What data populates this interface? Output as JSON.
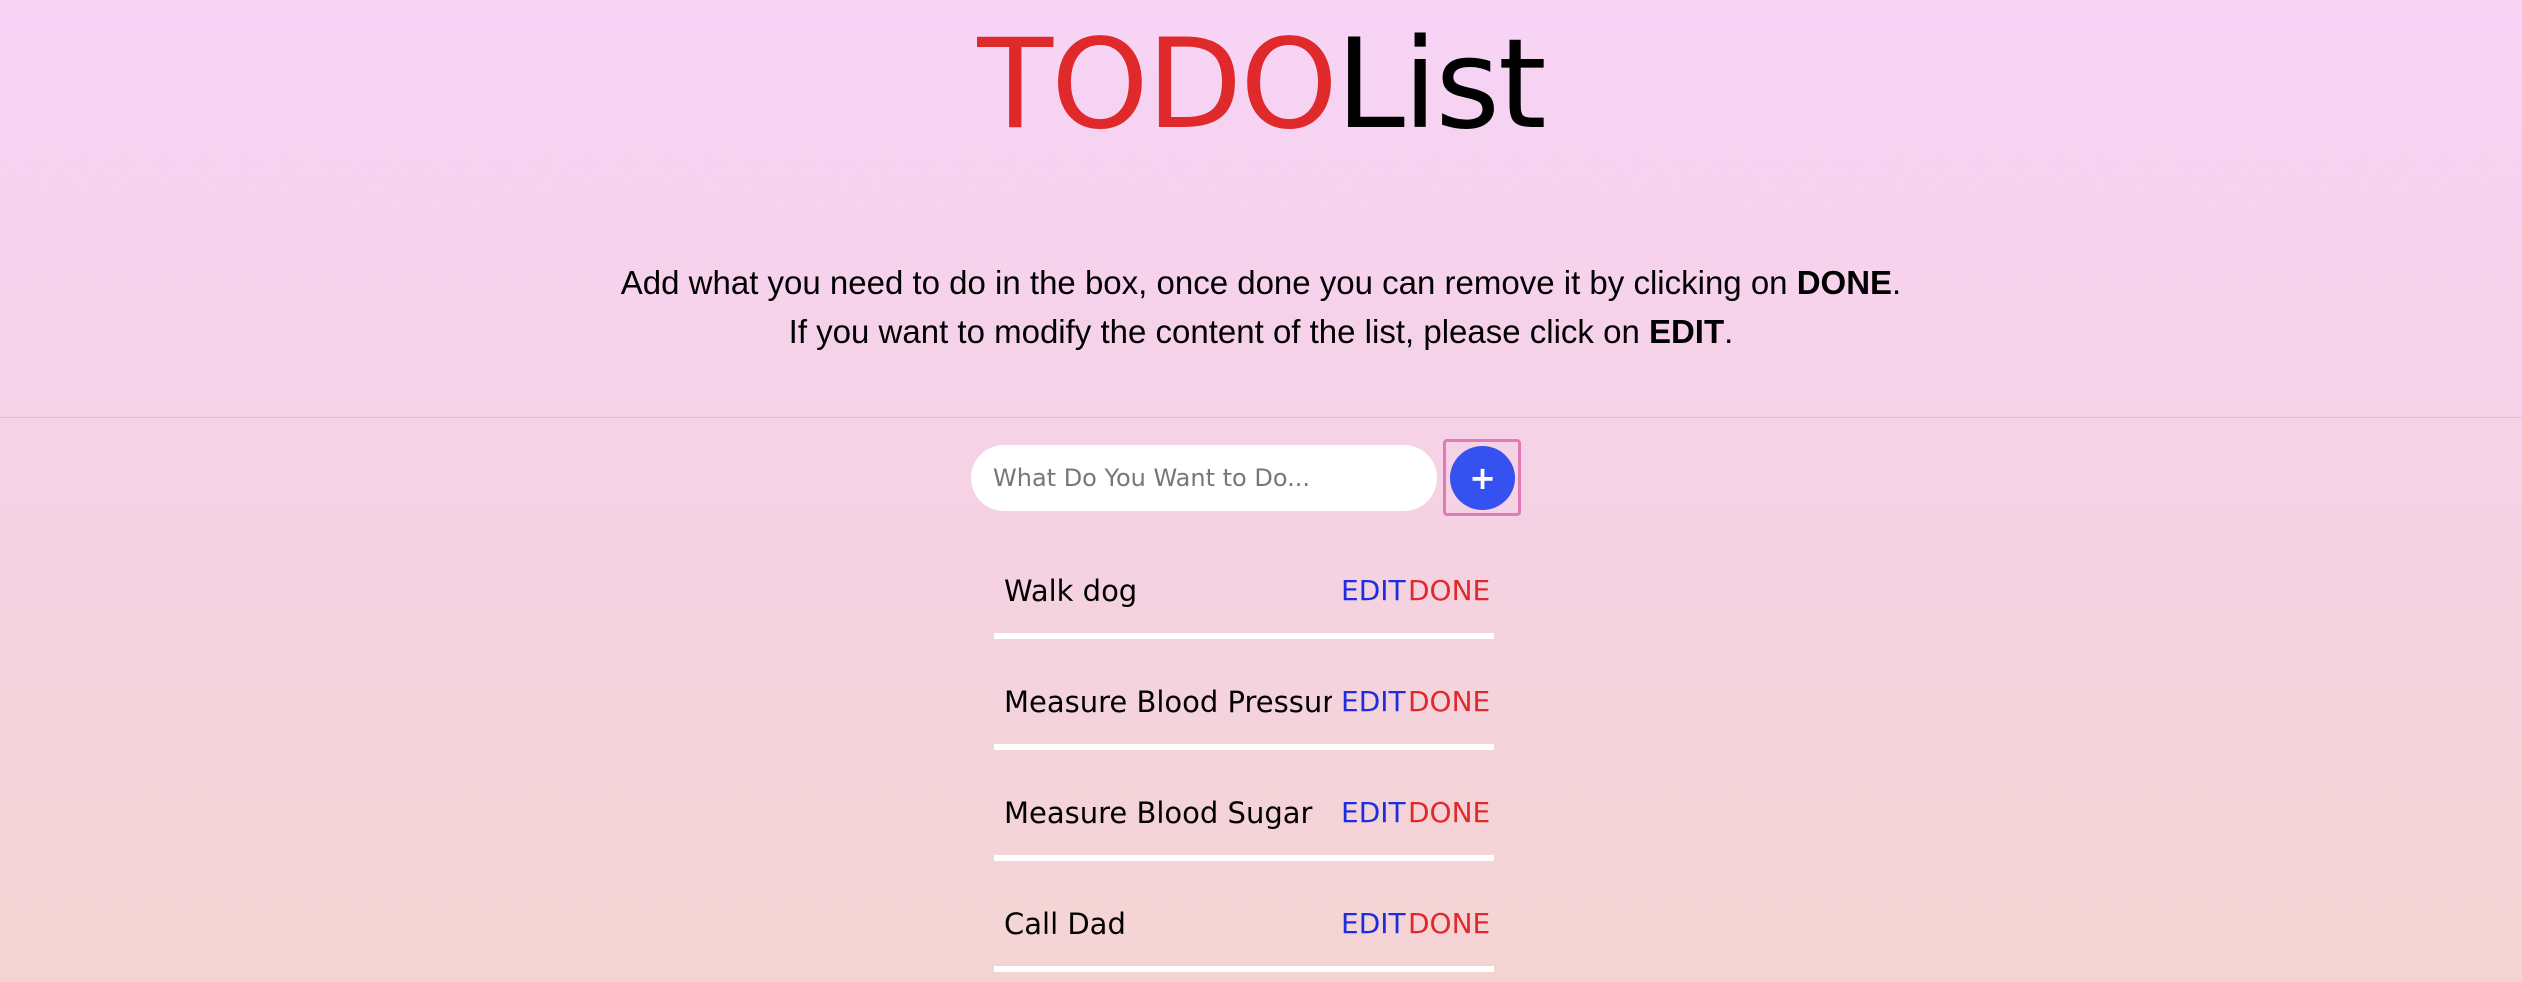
{
  "header": {
    "title_part1": "TODO",
    "title_part2": "List"
  },
  "instructions": {
    "line1_text": "Add what you need to do in the box, once done you can remove it by clicking on ",
    "line1_bold": "DONE",
    "line1_end": ".",
    "line2_text": "If you want to modify the content of the list, please click on ",
    "line2_bold": "EDIT",
    "line2_end": "."
  },
  "form": {
    "input_value": "",
    "input_placeholder": "What Do You Want to Do...",
    "add_label": "+"
  },
  "todos": [
    {
      "text": "Walk dog",
      "edit_label": "EDIT",
      "done_label": "DONE"
    },
    {
      "text": "Measure Blood Pressure",
      "edit_label": "EDIT",
      "done_label": "DONE"
    },
    {
      "text": "Measure Blood Sugar",
      "edit_label": "EDIT",
      "done_label": "DONE"
    },
    {
      "text": "Call Dad",
      "edit_label": "EDIT",
      "done_label": "DONE"
    }
  ],
  "colors": {
    "accent_red": "#e0292b",
    "edit_blue": "#1f2de0",
    "add_button_blue": "#3551ef",
    "focus_ring_pink": "#e27bb5"
  },
  "icons": {
    "add": "plus-icon"
  }
}
